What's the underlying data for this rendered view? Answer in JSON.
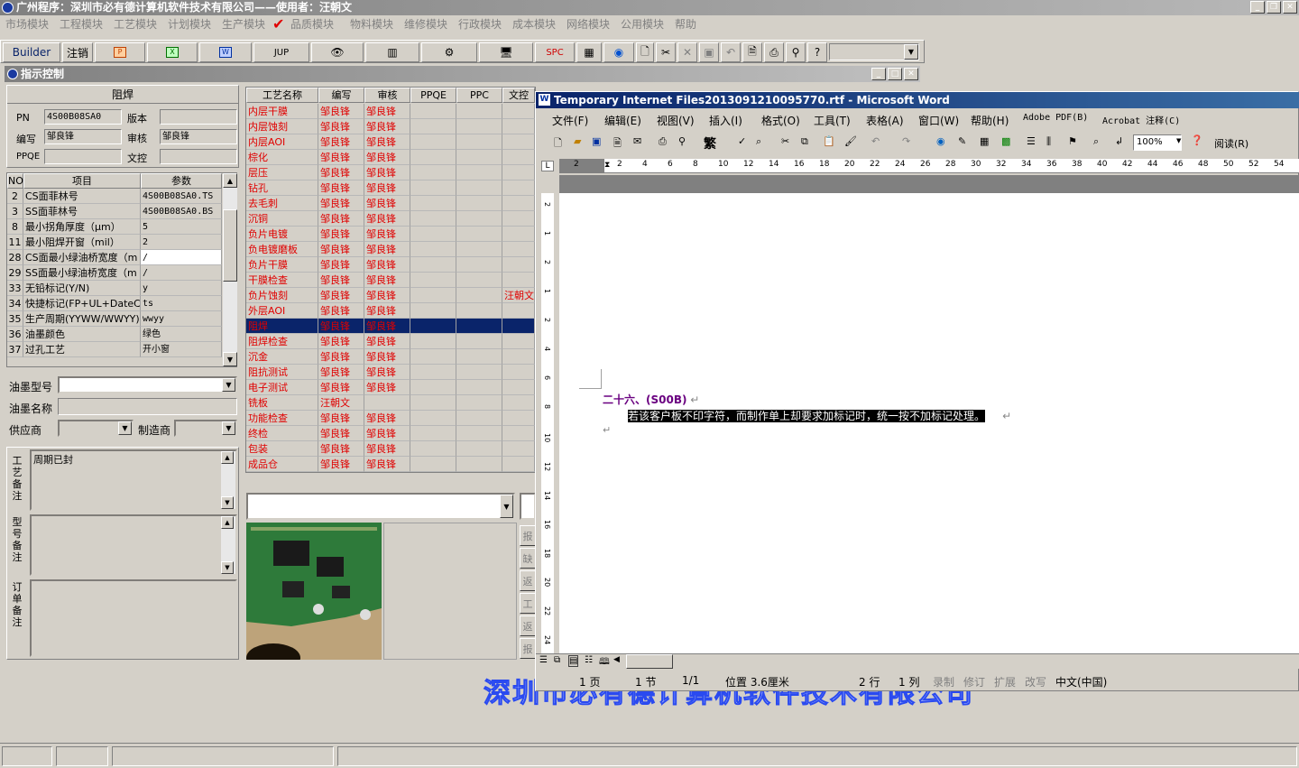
{
  "app": {
    "title": "广州程序：深圳市必有德计算机软件技术有限公司——使用者：汪朝文"
  },
  "menu": [
    "市场模块",
    "工程模块",
    "工艺模块",
    "计划模块",
    "生产模块",
    "品质模块",
    "物料模块",
    "维修模块",
    "行政模块",
    "成本模块",
    "网络模块",
    "公用模块",
    "帮助"
  ],
  "toolbar": {
    "builder": "Builder",
    "logout": "注销",
    "jup": "JUP",
    "spc": "SPC"
  },
  "window": {
    "title": "指示控制"
  },
  "left": {
    "section_title": "阻焊",
    "pn_label": "PN",
    "pn_value": "4S00B08SA0",
    "version_label": "版本",
    "version_value": "",
    "writer_label": "编写",
    "writer_value": "邹良锋",
    "reviewer_label": "审核",
    "reviewer_value": "邹良锋",
    "ppqe_label": "PPQE",
    "ppqe_value": "",
    "wenkong_label": "文控",
    "wenkong_value": ""
  },
  "params": {
    "headers": [
      "NO",
      "项目",
      "参数"
    ],
    "rows": [
      {
        "no": "2",
        "item": "CS面菲林号",
        "value": "4S00B08SA0.TS"
      },
      {
        "no": "3",
        "item": "SS面菲林号",
        "value": "4S00B08SA0.BS"
      },
      {
        "no": "8",
        "item": "最小拐角厚度（μm）",
        "value": "5"
      },
      {
        "no": "11",
        "item": "最小阻焊开窗（mil）",
        "value": "2"
      },
      {
        "no": "28",
        "item": "CS面最小绿油桥宽度（m",
        "value": "/"
      },
      {
        "no": "29",
        "item": "SS面最小绿油桥宽度（m",
        "value": "/"
      },
      {
        "no": "33",
        "item": "无铅标记(Y/N)",
        "value": "y"
      },
      {
        "no": "34",
        "item": "快捷标记(FP+UL+DateCo",
        "value": "ts"
      },
      {
        "no": "35",
        "item": "生产周期(YYWW/WWYY)",
        "value": "wwyy"
      },
      {
        "no": "36",
        "item": "油墨颜色",
        "value": "绿色"
      },
      {
        "no": "37",
        "item": "过孔工艺",
        "value": "开小窗"
      }
    ]
  },
  "ink": {
    "model_label": "油墨型号",
    "name_label": "油墨名称",
    "supplier_label": "供应商",
    "maker_label": "制造商"
  },
  "notes": {
    "process_label": "工艺备注",
    "process_value": "周期已封",
    "model_label": "型号备注",
    "order_label": "订单备注"
  },
  "process": {
    "headers": [
      "工艺名称",
      "编写",
      "审核",
      "PPQE",
      "PPC",
      "文控"
    ],
    "rows": [
      {
        "name": "内层干膜",
        "w": "邹良锋",
        "r": "邹良锋",
        "wk": ""
      },
      {
        "name": "内层蚀刻",
        "w": "邹良锋",
        "r": "邹良锋",
        "wk": ""
      },
      {
        "name": "内层AOI",
        "w": "邹良锋",
        "r": "邹良锋",
        "wk": ""
      },
      {
        "name": "棕化",
        "w": "邹良锋",
        "r": "邹良锋",
        "wk": ""
      },
      {
        "name": "层压",
        "w": "邹良锋",
        "r": "邹良锋",
        "wk": ""
      },
      {
        "name": "钻孔",
        "w": "邹良锋",
        "r": "邹良锋",
        "wk": ""
      },
      {
        "name": "去毛刺",
        "w": "邹良锋",
        "r": "邹良锋",
        "wk": ""
      },
      {
        "name": "沉铜",
        "w": "邹良锋",
        "r": "邹良锋",
        "wk": ""
      },
      {
        "name": "负片电镀",
        "w": "邹良锋",
        "r": "邹良锋",
        "wk": ""
      },
      {
        "name": "负电镀磨板",
        "w": "邹良锋",
        "r": "邹良锋",
        "wk": ""
      },
      {
        "name": "负片干膜",
        "w": "邹良锋",
        "r": "邹良锋",
        "wk": ""
      },
      {
        "name": "干膜检查",
        "w": "邹良锋",
        "r": "邹良锋",
        "wk": ""
      },
      {
        "name": "负片蚀刻",
        "w": "邹良锋",
        "r": "邹良锋",
        "wk": "汪朝文"
      },
      {
        "name": "外层AOI",
        "w": "邹良锋",
        "r": "邹良锋",
        "wk": ""
      },
      {
        "name": "阻焊",
        "w": "邹良锋",
        "r": "邹良锋",
        "wk": ""
      },
      {
        "name": "阻焊检查",
        "w": "邹良锋",
        "r": "邹良锋",
        "wk": ""
      },
      {
        "name": "沉金",
        "w": "邹良锋",
        "r": "邹良锋",
        "wk": ""
      },
      {
        "name": "阻抗测试",
        "w": "邹良锋",
        "r": "邹良锋",
        "wk": ""
      },
      {
        "name": "电子测试",
        "w": "邹良锋",
        "r": "邹良锋",
        "wk": ""
      },
      {
        "name": "铣板",
        "w": "汪朝文",
        "r": "",
        "wk": ""
      },
      {
        "name": "功能检查",
        "w": "邹良锋",
        "r": "邹良锋",
        "wk": ""
      },
      {
        "name": "终检",
        "w": "邹良锋",
        "r": "邹良锋",
        "wk": ""
      },
      {
        "name": "包装",
        "w": "邹良锋",
        "r": "邹良锋",
        "wk": ""
      },
      {
        "name": "成品仓",
        "w": "邹良锋",
        "r": "邹良锋",
        "wk": ""
      }
    ],
    "selected_index": 14
  },
  "side_buttons": [
    "报",
    "缺",
    "返",
    "工",
    "返",
    "报"
  ],
  "word": {
    "title": "Temporary Internet Files2013091210095770.rtf - Microsoft Word",
    "menu": [
      "文件(F)",
      "编辑(E)",
      "视图(V)",
      "插入(I)",
      "格式(O)",
      "工具(T)",
      "表格(A)",
      "窗口(W)",
      "帮助(H)",
      "Adobe PDF(B)",
      "Acrobat 注释(C)"
    ],
    "font_glyph": "繁",
    "zoom": "100%",
    "read": "阅读(R)",
    "ruler": [
      "2",
      "2",
      "4",
      "6",
      "8",
      "10",
      "12",
      "14",
      "16",
      "18",
      "20",
      "22",
      "24",
      "26",
      "28",
      "30",
      "32",
      "34",
      "36",
      "38",
      "40",
      "42",
      "44",
      "46",
      "48",
      "50",
      "52",
      "54"
    ],
    "vruler": [
      "2",
      "1",
      "2",
      "1",
      "2",
      "4",
      "6",
      "8",
      "10",
      "12",
      "14",
      "16",
      "18",
      "20",
      "22",
      "24"
    ],
    "heading": "二十六、(S00B)",
    "body": "若该客户板不印字符，而制作单上却要求加标记时，统一按不加标记处理。",
    "status": {
      "page": "1 页",
      "section": "1 节",
      "pages": "1/1",
      "pos": "位置 3.6厘米",
      "line": "2 行",
      "col": "1 列",
      "rec": "录制",
      "rev": "修订",
      "ext": "扩展",
      "ovr": "改写",
      "lang": "中文(中国)"
    }
  },
  "watermark": "深圳市必有德计算机软件技术有限公司",
  "colors": {
    "title_gray": "#808080",
    "word_title": "#0a246a",
    "selection": "#0a246a",
    "red": "#e00000"
  }
}
